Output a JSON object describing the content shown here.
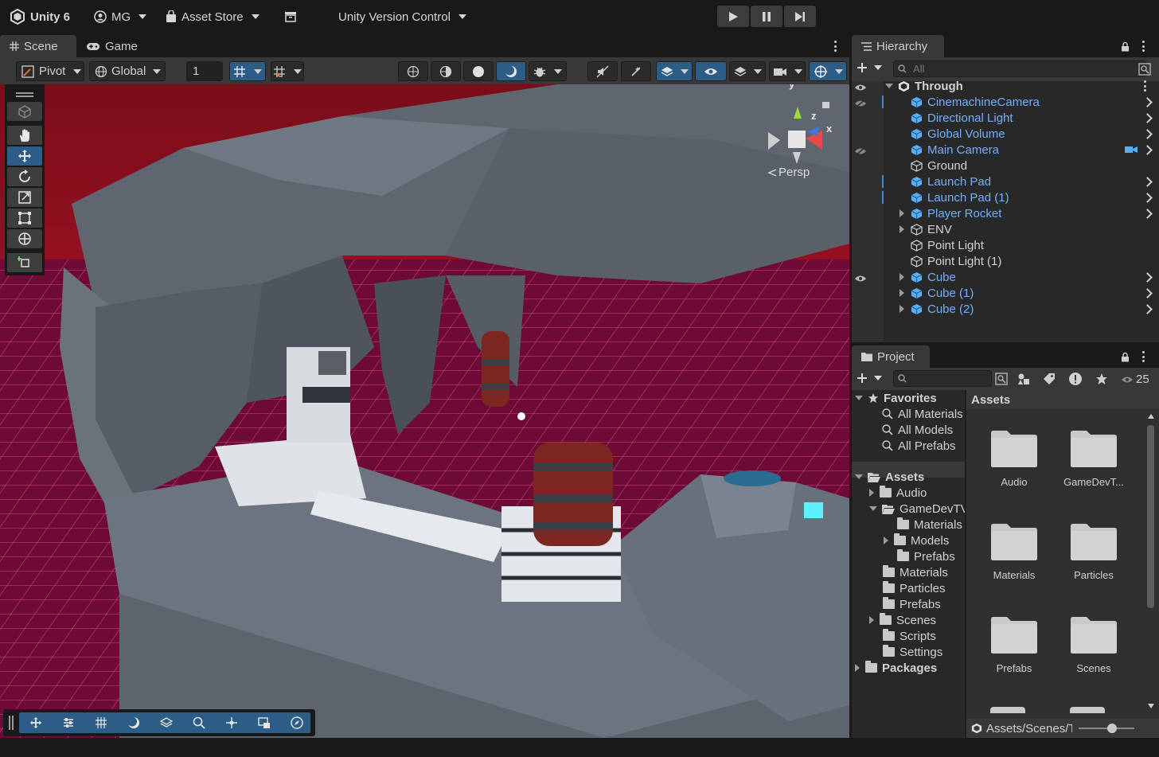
{
  "topbar": {
    "app_title": "Unity 6",
    "account": "MG",
    "asset_store": "Asset Store",
    "version_control": "Unity Version Control"
  },
  "scene_panel": {
    "tabs": [
      {
        "label": "Scene",
        "icon": "grid-icon"
      },
      {
        "label": "Game",
        "icon": "gamepad-icon"
      }
    ],
    "toolbar": {
      "pivot": "Pivot",
      "global": "Global",
      "grid_size": "1"
    },
    "gizmo": {
      "axis_x": "x",
      "axis_y": "y",
      "axis_z": "z",
      "projection": "Persp"
    }
  },
  "hierarchy": {
    "tab_label": "Hierarchy",
    "search_placeholder": "All",
    "scene_name": "Through",
    "items": [
      {
        "label": "CinemachineCamera",
        "prefab": true
      },
      {
        "label": "Directional Light",
        "prefab": true
      },
      {
        "label": "Global Volume",
        "prefab": true
      },
      {
        "label": "Main Camera",
        "prefab": true
      },
      {
        "label": "Ground",
        "prefab": false
      },
      {
        "label": "Launch Pad",
        "prefab": true
      },
      {
        "label": "Launch Pad (1)",
        "prefab": true
      },
      {
        "label": "Player Rocket",
        "prefab": true
      },
      {
        "label": "ENV",
        "prefab": false
      },
      {
        "label": "Point Light",
        "prefab": false
      },
      {
        "label": "Point Light (1)",
        "prefab": false
      },
      {
        "label": "Cube",
        "prefab": true
      },
      {
        "label": "Cube (1)",
        "prefab": true
      },
      {
        "label": "Cube (2)",
        "prefab": true
      }
    ]
  },
  "project": {
    "tab_label": "Project",
    "hidden_count": "25",
    "favorites": {
      "label": "Favorites",
      "items": [
        "All Materials",
        "All Models",
        "All Prefabs"
      ]
    },
    "tree": {
      "assets": "Assets",
      "audio": "Audio",
      "gamedevtv": "GameDevTV",
      "gd_materials": "Materials",
      "gd_models": "Models",
      "gd_prefabs": "Prefabs",
      "materials": "Materials",
      "particles": "Particles",
      "prefabs": "Prefabs",
      "scenes": "Scenes",
      "scripts": "Scripts",
      "settings": "Settings",
      "packages": "Packages"
    },
    "breadcrumb": "Assets",
    "grid_items": [
      "Audio",
      "GameDevT...",
      "Materials",
      "Particles",
      "Prefabs",
      "Scenes"
    ],
    "footer_path": "Assets/Scenes/Tl"
  },
  "colors": {
    "accent_blue": "#2c5d87",
    "prefab_text": "#6fb1ff",
    "scene_floor": "#7a0e3a"
  }
}
